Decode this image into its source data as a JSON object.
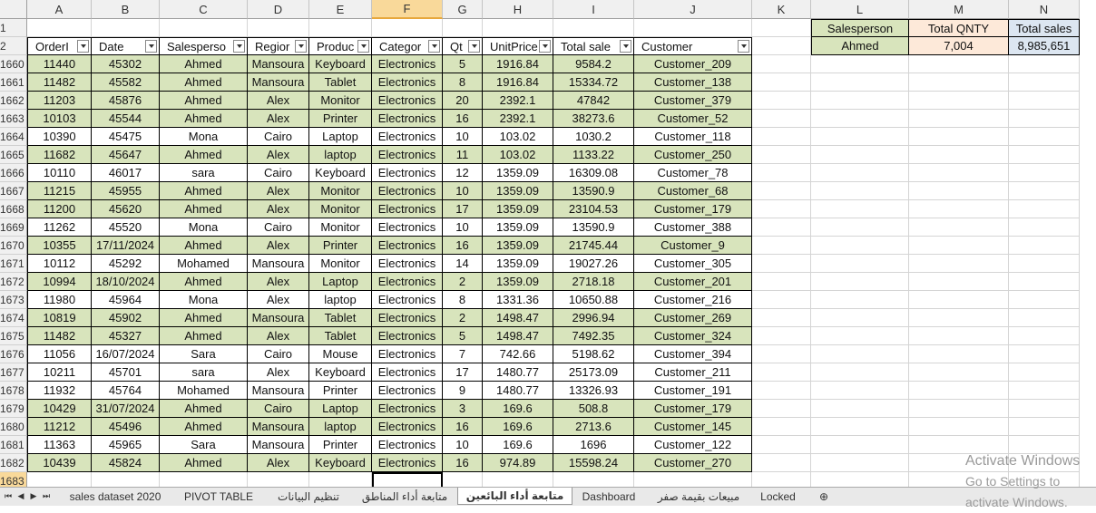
{
  "columns": [
    "A",
    "B",
    "C",
    "D",
    "E",
    "F",
    "G",
    "H",
    "I",
    "J",
    "K",
    "L",
    "M",
    "N"
  ],
  "selected_column": "F",
  "row_numbers": [
    "1",
    "2",
    "1660",
    "1661",
    "1662",
    "1663",
    "1664",
    "1665",
    "1666",
    "1667",
    "1668",
    "1669",
    "1670",
    "1671",
    "1672",
    "1673",
    "1674",
    "1675",
    "1676",
    "1677",
    "1678",
    "1679",
    "1680",
    "1681",
    "1682",
    "1683"
  ],
  "table_headers": [
    "OrderI",
    "Date",
    "Salesperso",
    "Regior",
    "Produc",
    "Categor",
    "Qt",
    "UnitPrice",
    "Total sale",
    "Customer"
  ],
  "rows": [
    [
      "11440",
      "45302",
      "Ahmed",
      "Mansoura",
      "Keyboard",
      "Electronics",
      "5",
      "1916.84",
      "9584.2",
      "Customer_209"
    ],
    [
      "11482",
      "45582",
      "Ahmed",
      "Mansoura",
      "Tablet",
      "Electronics",
      "8",
      "1916.84",
      "15334.72",
      "Customer_138"
    ],
    [
      "11203",
      "45876",
      "Ahmed",
      "Alex",
      "Monitor",
      "Electronics",
      "20",
      "2392.1",
      "47842",
      "Customer_379"
    ],
    [
      "10103",
      "45544",
      "Ahmed",
      "Alex",
      "Printer",
      "Electronics",
      "16",
      "2392.1",
      "38273.6",
      "Customer_52"
    ],
    [
      "10390",
      "45475",
      "Mona",
      "Cairo",
      "Laptop",
      "Electronics",
      "10",
      "103.02",
      "1030.2",
      "Customer_118"
    ],
    [
      "11682",
      "45647",
      "Ahmed",
      "Alex",
      "laptop",
      "Electronics",
      "11",
      "103.02",
      "1133.22",
      "Customer_250"
    ],
    [
      "10110",
      "46017",
      "sara",
      "Cairo",
      "Keyboard",
      "Electronics",
      "12",
      "1359.09",
      "16309.08",
      "Customer_78"
    ],
    [
      "11215",
      "45955",
      "Ahmed",
      "Alex",
      "Monitor",
      "Electronics",
      "10",
      "1359.09",
      "13590.9",
      "Customer_68"
    ],
    [
      "11200",
      "45620",
      "Ahmed",
      "Alex",
      "Monitor",
      "Electronics",
      "17",
      "1359.09",
      "23104.53",
      "Customer_179"
    ],
    [
      "11262",
      "45520",
      "Mona",
      "Cairo",
      "Monitor",
      "Electronics",
      "10",
      "1359.09",
      "13590.9",
      "Customer_388"
    ],
    [
      "10355",
      "17/11/2024",
      "Ahmed",
      "Alex",
      "Printer",
      "Electronics",
      "16",
      "1359.09",
      "21745.44",
      "Customer_9"
    ],
    [
      "10112",
      "45292",
      "Mohamed",
      "Mansoura",
      "Monitor",
      "Electronics",
      "14",
      "1359.09",
      "19027.26",
      "Customer_305"
    ],
    [
      "10994",
      "18/10/2024",
      "Ahmed",
      "Alex",
      "Laptop",
      "Electronics",
      "2",
      "1359.09",
      "2718.18",
      "Customer_201"
    ],
    [
      "11980",
      "45964",
      "Mona",
      "Alex",
      "laptop",
      "Electronics",
      "8",
      "1331.36",
      "10650.88",
      "Customer_216"
    ],
    [
      "10819",
      "45902",
      "Ahmed",
      "Mansoura",
      "Tablet",
      "Electronics",
      "2",
      "1498.47",
      "2996.94",
      "Customer_269"
    ],
    [
      "11482",
      "45327",
      "Ahmed",
      "Alex",
      "Tablet",
      "Electronics",
      "5",
      "1498.47",
      "7492.35",
      "Customer_324"
    ],
    [
      "11056",
      "16/07/2024",
      "Sara",
      "Cairo",
      "Mouse",
      "Electronics",
      "7",
      "742.66",
      "5198.62",
      "Customer_394"
    ],
    [
      "10211",
      "45701",
      "sara",
      "Alex",
      "Keyboard",
      "Electronics",
      "17",
      "1480.77",
      "25173.09",
      "Customer_211"
    ],
    [
      "11932",
      "45764",
      "Mohamed",
      "Mansoura",
      "Printer",
      "Electronics",
      "9",
      "1480.77",
      "13326.93",
      "Customer_191"
    ],
    [
      "10429",
      "31/07/2024",
      "Ahmed",
      "Cairo",
      "Laptop",
      "Electronics",
      "3",
      "169.6",
      "508.8",
      "Customer_179"
    ],
    [
      "11212",
      "45496",
      "Ahmed",
      "Mansoura",
      "laptop",
      "Electronics",
      "16",
      "169.6",
      "2713.6",
      "Customer_145"
    ],
    [
      "11363",
      "45965",
      "Sara",
      "Mansoura",
      "Printer",
      "Electronics",
      "10",
      "169.6",
      "1696",
      "Customer_122"
    ],
    [
      "10439",
      "45824",
      "Ahmed",
      "Alex",
      "Keyboard",
      "Electronics",
      "16",
      "974.89",
      "15598.24",
      "Customer_270"
    ]
  ],
  "green_rows": [
    0,
    1,
    2,
    3,
    5,
    7,
    8,
    10,
    12,
    14,
    15,
    19,
    20,
    22
  ],
  "summary": {
    "headers": [
      "Salesperson",
      "Total QNTY",
      "Total sales"
    ],
    "values": [
      "Ahmed",
      "7,004",
      "8,985,651"
    ]
  },
  "sheet_tabs": [
    "sales dataset 2020",
    "PIVOT TABLE",
    "تنظيم البيانات",
    "متابعة أداء المناطق",
    "متابعة أداء البائعين",
    "Dashboard",
    "مبيعات بقيمة صفر",
    "Locked"
  ],
  "active_tab": 4,
  "watermark": {
    "line1": "Activate Windows",
    "line2": "Go to Settings to activate Windows."
  },
  "colors": {
    "green": "#d8e4bc",
    "peach": "#fde9d9",
    "light_blue": "#dce6f1",
    "selected_header": "#f9d99a"
  }
}
